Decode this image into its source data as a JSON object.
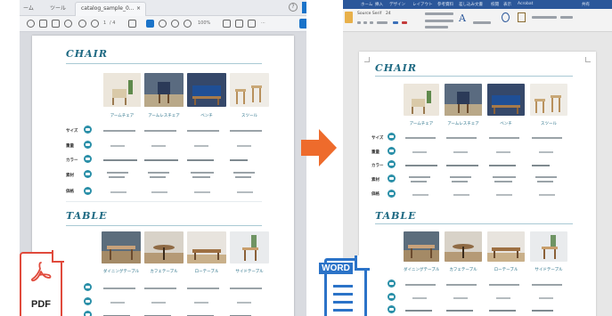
{
  "pdf_viewer": {
    "tabbar": {
      "menu_label": "ーム",
      "tools_label": "ツール",
      "tab_title": "catalog_sample_0...",
      "close_symbol": "×",
      "help_symbol": "?"
    },
    "toolbar": {
      "page_number": "1",
      "page_total": "/ 4",
      "zoom": "100%"
    },
    "document": {
      "section1_title": "CHAIR",
      "chair_captions": [
        "アームチェア",
        "アームレスチェア",
        "ベンチ",
        "スツール"
      ],
      "chair_row_labels": [
        "サイズ",
        "重量",
        "カラー",
        "素材",
        "価格"
      ],
      "section2_title": "TABLE",
      "table_captions": [
        "ダイニングテーブル",
        "カフェテーブル",
        "ローテーブル",
        "サイドテーブル"
      ]
    }
  },
  "word_window": {
    "ribbon_tabs": [
      "ホーム",
      "挿入",
      "デザイン",
      "レイアウト",
      "参考資料",
      "差し込み文書",
      "校閲",
      "表示",
      "Acrobat"
    ],
    "share_label": "共有",
    "font_name": "Source Serif",
    "font_size": "24",
    "document": {
      "section1_title": "CHAIR",
      "chair_captions": [
        "アームチェア",
        "アームレスチェア",
        "ベンチ",
        "スツール"
      ],
      "chair_row_labels": [
        "サイズ",
        "重量",
        "カラー",
        "素材",
        "価格"
      ],
      "section2_title": "TABLE",
      "table_captions": [
        "ダイニングテーブル",
        "カフェテーブル",
        "ローテーブル",
        "サイドテーブル"
      ]
    }
  },
  "pdf_badge": {
    "label": "PDF",
    "icon": "acrobat-logo-icon"
  },
  "word_badge": {
    "label": "WORD",
    "icon": "word-document-icon"
  },
  "arrow_icon": "right-arrow-icon",
  "colors": {
    "heading": "#1f6a83",
    "accent_dot": "#2a8fa8",
    "arrow": "#ee6b2c",
    "pdf_red": "#e04a3c",
    "word_blue": "#2b73c8"
  }
}
